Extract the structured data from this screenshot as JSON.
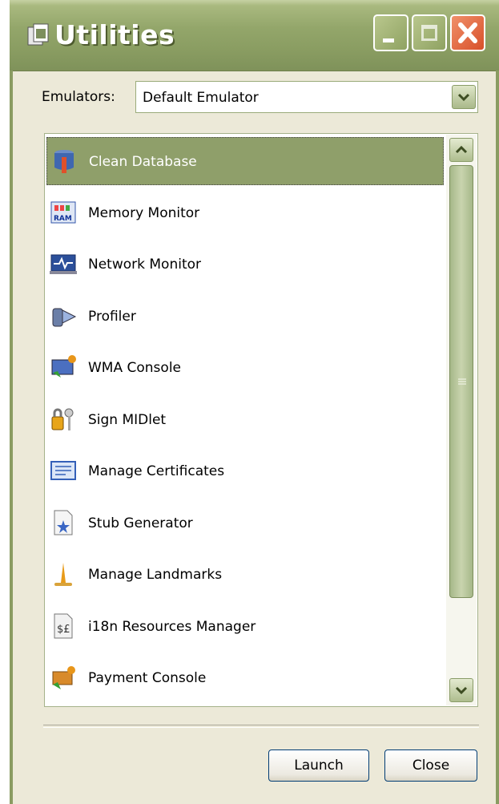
{
  "window": {
    "title": "Utilities"
  },
  "emulators": {
    "label": "Emulators:",
    "selected": "Default Emulator"
  },
  "tools": [
    {
      "label": "Clean Database",
      "icon": "database-cleaner-icon",
      "selected": true
    },
    {
      "label": "Memory Monitor",
      "icon": "ram-icon",
      "selected": false
    },
    {
      "label": "Network Monitor",
      "icon": "network-monitor-icon",
      "selected": false
    },
    {
      "label": "Profiler",
      "icon": "profiler-icon",
      "selected": false
    },
    {
      "label": "WMA Console",
      "icon": "wma-console-icon",
      "selected": false
    },
    {
      "label": "Sign MIDlet",
      "icon": "lock-key-icon",
      "selected": false
    },
    {
      "label": "Manage Certificates",
      "icon": "certificate-icon",
      "selected": false
    },
    {
      "label": "Stub Generator",
      "icon": "stub-document-icon",
      "selected": false
    },
    {
      "label": "Manage Landmarks",
      "icon": "landmark-icon",
      "selected": false
    },
    {
      "label": "i18n Resources Manager",
      "icon": "currency-document-icon",
      "selected": false
    },
    {
      "label": "Payment Console",
      "icon": "payment-console-icon",
      "selected": false
    }
  ],
  "buttons": {
    "launch": "Launch",
    "close": "Close"
  },
  "colors": {
    "titlebar": "#8a9d62",
    "selection": "#8f9f6a",
    "close_button": "#d8502a"
  }
}
